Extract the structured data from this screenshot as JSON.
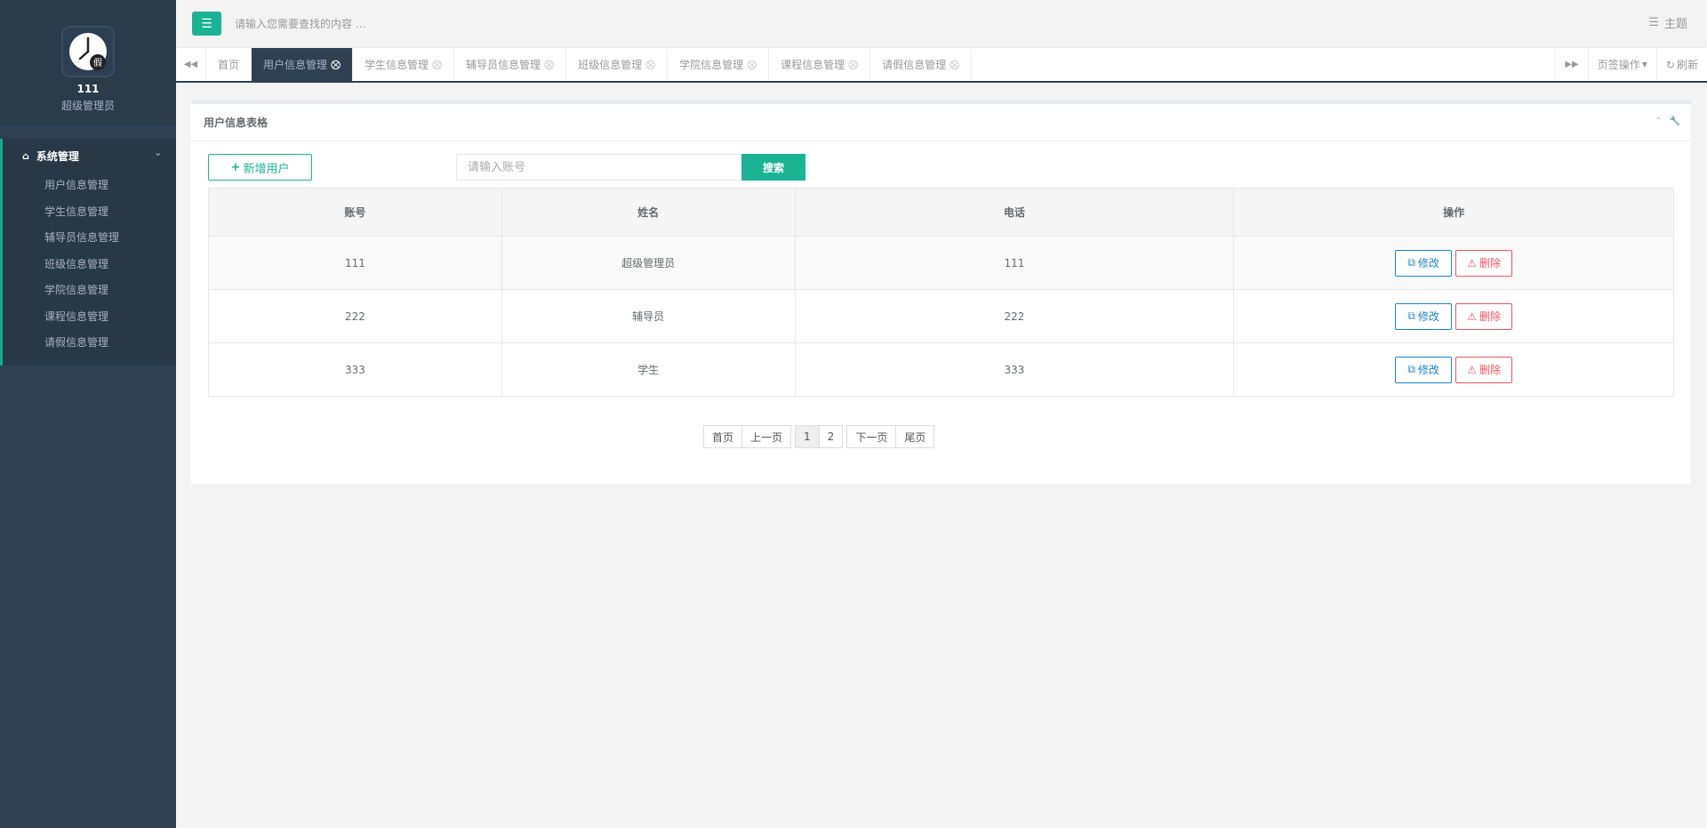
{
  "profile": {
    "logo_char": "假",
    "name": "111",
    "role": "超级管理员"
  },
  "sidebar": {
    "group_label": "系统管理",
    "items": [
      {
        "label": "用户信息管理"
      },
      {
        "label": "学生信息管理"
      },
      {
        "label": "辅导员信息管理"
      },
      {
        "label": "班级信息管理"
      },
      {
        "label": "学院信息管理"
      },
      {
        "label": "课程信息管理"
      },
      {
        "label": "请假信息管理"
      }
    ]
  },
  "topbar": {
    "search_placeholder": "请输入您需要查找的内容 …",
    "theme_label": "主题"
  },
  "tabs": [
    {
      "label": "首页"
    },
    {
      "label": "用户信息管理"
    },
    {
      "label": "学生信息管理"
    },
    {
      "label": "辅导员信息管理"
    },
    {
      "label": "班级信息管理"
    },
    {
      "label": "学院信息管理"
    },
    {
      "label": "课程信息管理"
    },
    {
      "label": "请假信息管理"
    }
  ],
  "tabs_right": {
    "page_ops": "页签操作",
    "refresh": "刷新"
  },
  "panel": {
    "title": "用户信息表格",
    "add_label": "新增用户",
    "search_placeholder": "请输入账号",
    "search_label": "搜索"
  },
  "table": {
    "headers": [
      "账号",
      "姓名",
      "电话",
      "操作"
    ],
    "rows": [
      {
        "account": "111",
        "name": "超级管理员",
        "phone": "111"
      },
      {
        "account": "222",
        "name": "辅导员",
        "phone": "222"
      },
      {
        "account": "333",
        "name": "学生",
        "phone": "333"
      }
    ],
    "edit_label": "修改",
    "delete_label": "删除"
  },
  "pagination": {
    "first": "首页",
    "prev": "上一页",
    "pages": [
      "1",
      "2"
    ],
    "next": "下一页",
    "last": "尾页"
  },
  "colors": {
    "accent": "#1ab394",
    "sidebar": "#2f4050",
    "edit": "#1c84c6",
    "delete": "#ed5565"
  }
}
